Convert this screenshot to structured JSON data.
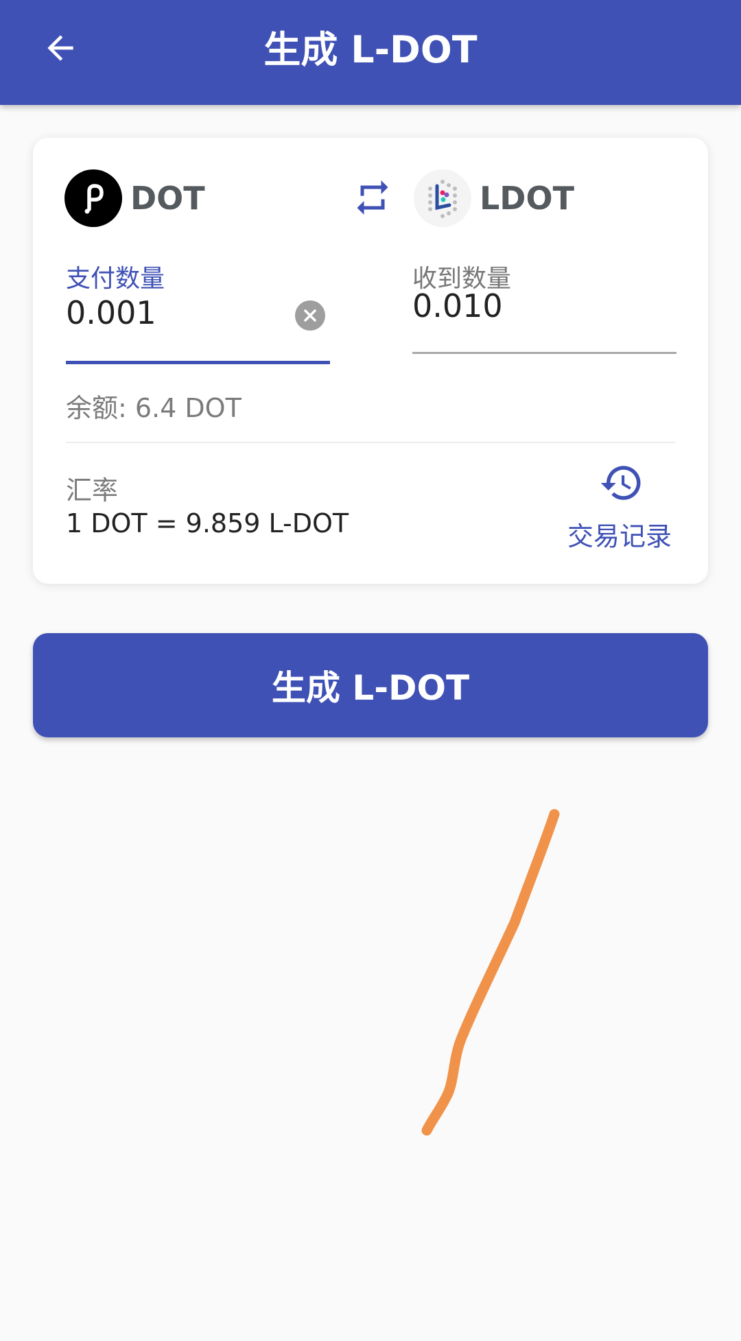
{
  "appbar": {
    "title": "生成 L-DOT"
  },
  "swap": {
    "from_token": "DOT",
    "to_token": "LDOT",
    "pay_label": "支付数量",
    "pay_value": "0.001",
    "receive_label": "收到数量",
    "receive_value": "0.010",
    "balance": "余额: 6.4 DOT"
  },
  "rate": {
    "label": "汇率",
    "value": "1 DOT = 9.859 L-DOT"
  },
  "history": {
    "label": "交易记录"
  },
  "action": {
    "generate_label": "生成 L-DOT"
  },
  "colors": {
    "primary": "#3f51b5",
    "background": "#fafafa",
    "scribble": "#f0924a"
  },
  "icons": [
    "back-arrow-icon",
    "polkadot-logo-icon",
    "swap-arrows-icon",
    "ldot-logo-icon",
    "clear-icon",
    "history-icon"
  ]
}
